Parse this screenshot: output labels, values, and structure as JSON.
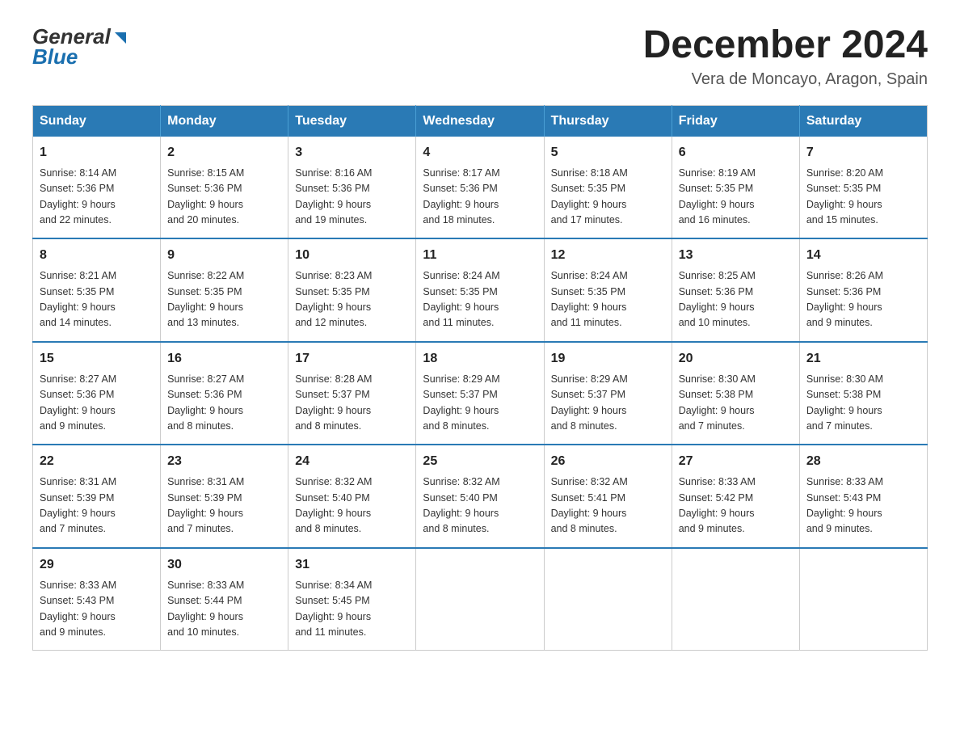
{
  "header": {
    "logo_general": "General",
    "logo_blue": "Blue",
    "month_year": "December 2024",
    "location": "Vera de Moncayo, Aragon, Spain"
  },
  "days_of_week": [
    "Sunday",
    "Monday",
    "Tuesday",
    "Wednesday",
    "Thursday",
    "Friday",
    "Saturday"
  ],
  "weeks": [
    [
      {
        "day": "1",
        "sunrise": "8:14 AM",
        "sunset": "5:36 PM",
        "daylight": "9 hours and 22 minutes."
      },
      {
        "day": "2",
        "sunrise": "8:15 AM",
        "sunset": "5:36 PM",
        "daylight": "9 hours and 20 minutes."
      },
      {
        "day": "3",
        "sunrise": "8:16 AM",
        "sunset": "5:36 PM",
        "daylight": "9 hours and 19 minutes."
      },
      {
        "day": "4",
        "sunrise": "8:17 AM",
        "sunset": "5:36 PM",
        "daylight": "9 hours and 18 minutes."
      },
      {
        "day": "5",
        "sunrise": "8:18 AM",
        "sunset": "5:35 PM",
        "daylight": "9 hours and 17 minutes."
      },
      {
        "day": "6",
        "sunrise": "8:19 AM",
        "sunset": "5:35 PM",
        "daylight": "9 hours and 16 minutes."
      },
      {
        "day": "7",
        "sunrise": "8:20 AM",
        "sunset": "5:35 PM",
        "daylight": "9 hours and 15 minutes."
      }
    ],
    [
      {
        "day": "8",
        "sunrise": "8:21 AM",
        "sunset": "5:35 PM",
        "daylight": "9 hours and 14 minutes."
      },
      {
        "day": "9",
        "sunrise": "8:22 AM",
        "sunset": "5:35 PM",
        "daylight": "9 hours and 13 minutes."
      },
      {
        "day": "10",
        "sunrise": "8:23 AM",
        "sunset": "5:35 PM",
        "daylight": "9 hours and 12 minutes."
      },
      {
        "day": "11",
        "sunrise": "8:24 AM",
        "sunset": "5:35 PM",
        "daylight": "9 hours and 11 minutes."
      },
      {
        "day": "12",
        "sunrise": "8:24 AM",
        "sunset": "5:35 PM",
        "daylight": "9 hours and 11 minutes."
      },
      {
        "day": "13",
        "sunrise": "8:25 AM",
        "sunset": "5:36 PM",
        "daylight": "9 hours and 10 minutes."
      },
      {
        "day": "14",
        "sunrise": "8:26 AM",
        "sunset": "5:36 PM",
        "daylight": "9 hours and 9 minutes."
      }
    ],
    [
      {
        "day": "15",
        "sunrise": "8:27 AM",
        "sunset": "5:36 PM",
        "daylight": "9 hours and 9 minutes."
      },
      {
        "day": "16",
        "sunrise": "8:27 AM",
        "sunset": "5:36 PM",
        "daylight": "9 hours and 8 minutes."
      },
      {
        "day": "17",
        "sunrise": "8:28 AM",
        "sunset": "5:37 PM",
        "daylight": "9 hours and 8 minutes."
      },
      {
        "day": "18",
        "sunrise": "8:29 AM",
        "sunset": "5:37 PM",
        "daylight": "9 hours and 8 minutes."
      },
      {
        "day": "19",
        "sunrise": "8:29 AM",
        "sunset": "5:37 PM",
        "daylight": "9 hours and 8 minutes."
      },
      {
        "day": "20",
        "sunrise": "8:30 AM",
        "sunset": "5:38 PM",
        "daylight": "9 hours and 7 minutes."
      },
      {
        "day": "21",
        "sunrise": "8:30 AM",
        "sunset": "5:38 PM",
        "daylight": "9 hours and 7 minutes."
      }
    ],
    [
      {
        "day": "22",
        "sunrise": "8:31 AM",
        "sunset": "5:39 PM",
        "daylight": "9 hours and 7 minutes."
      },
      {
        "day": "23",
        "sunrise": "8:31 AM",
        "sunset": "5:39 PM",
        "daylight": "9 hours and 7 minutes."
      },
      {
        "day": "24",
        "sunrise": "8:32 AM",
        "sunset": "5:40 PM",
        "daylight": "9 hours and 8 minutes."
      },
      {
        "day": "25",
        "sunrise": "8:32 AM",
        "sunset": "5:40 PM",
        "daylight": "9 hours and 8 minutes."
      },
      {
        "day": "26",
        "sunrise": "8:32 AM",
        "sunset": "5:41 PM",
        "daylight": "9 hours and 8 minutes."
      },
      {
        "day": "27",
        "sunrise": "8:33 AM",
        "sunset": "5:42 PM",
        "daylight": "9 hours and 9 minutes."
      },
      {
        "day": "28",
        "sunrise": "8:33 AM",
        "sunset": "5:43 PM",
        "daylight": "9 hours and 9 minutes."
      }
    ],
    [
      {
        "day": "29",
        "sunrise": "8:33 AM",
        "sunset": "5:43 PM",
        "daylight": "9 hours and 9 minutes."
      },
      {
        "day": "30",
        "sunrise": "8:33 AM",
        "sunset": "5:44 PM",
        "daylight": "9 hours and 10 minutes."
      },
      {
        "day": "31",
        "sunrise": "8:34 AM",
        "sunset": "5:45 PM",
        "daylight": "9 hours and 11 minutes."
      },
      null,
      null,
      null,
      null
    ]
  ],
  "labels": {
    "sunrise": "Sunrise:",
    "sunset": "Sunset:",
    "daylight": "Daylight:"
  }
}
